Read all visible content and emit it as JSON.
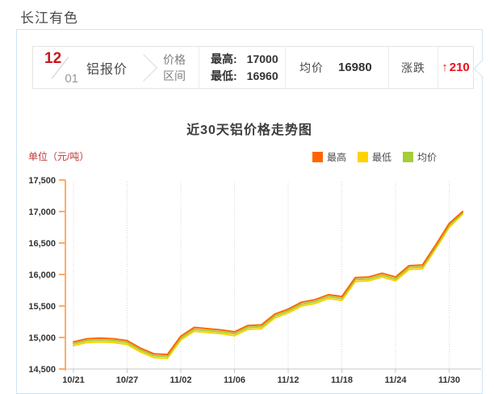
{
  "page_title": "长江有色",
  "quote_bar": {
    "date_month": "12",
    "date_day": "01",
    "product": "铝报价",
    "range_label_1": "价格",
    "range_label_2": "区间",
    "high_label": "最高:",
    "high_value": "17000",
    "low_label": "最低:",
    "low_value": "16960",
    "avg_label": "均价",
    "avg_value": "16980",
    "change_label": "涨跌",
    "change_arrow": "↑",
    "change_value": "210",
    "change_color": "#e8111d"
  },
  "chart": {
    "title": "近30天铝价格走势图",
    "unit_label": "单位（元/吨）"
  },
  "chart_data": {
    "type": "line",
    "title": "近30天铝价格走势图",
    "ylabel": "单位（元/吨）",
    "ylim": [
      14500,
      17500
    ],
    "y_ticks": [
      "17,500",
      "17,000",
      "16,500",
      "16,000",
      "15,500",
      "15,000",
      "14,500"
    ],
    "x_tick_labels": [
      "10/21",
      "10/27",
      "11/02",
      "11/06",
      "11/12",
      "11/18",
      "11/24",
      "11/30"
    ],
    "x_tick_indices": [
      0,
      4,
      8,
      12,
      16,
      20,
      24,
      28
    ],
    "grid": "vertical-dotted",
    "legend_position": "top-right",
    "axis_colors": {
      "y_axis": "#ffab66",
      "x_axis": "#c9c9c9",
      "gridline": "#d9d9d9",
      "tick_label": "#333333"
    },
    "draw_order": [
      1,
      2,
      0
    ],
    "series": [
      {
        "key": "high",
        "name": "最高",
        "color": "#ff6600",
        "values": [
          14930,
          14980,
          14990,
          14980,
          14950,
          14830,
          14740,
          14730,
          15020,
          15160,
          15140,
          15120,
          15090,
          15190,
          15200,
          15370,
          15450,
          15560,
          15600,
          15680,
          15650,
          15950,
          15960,
          16020,
          15960,
          16140,
          16150,
          16470,
          16810,
          17000
        ]
      },
      {
        "key": "low",
        "name": "最低",
        "color": "#ffd200",
        "values": [
          14870,
          14920,
          14930,
          14920,
          14890,
          14770,
          14680,
          14670,
          14960,
          15100,
          15080,
          15060,
          15030,
          15130,
          15140,
          15310,
          15390,
          15500,
          15540,
          15620,
          15590,
          15890,
          15900,
          15960,
          15900,
          16080,
          16090,
          16410,
          16750,
          16960
        ]
      },
      {
        "key": "avg",
        "name": "均价",
        "color": "#a5cd39",
        "values": [
          14900,
          14950,
          14960,
          14950,
          14920,
          14800,
          14710,
          14700,
          14990,
          15130,
          15110,
          15090,
          15060,
          15160,
          15170,
          15340,
          15420,
          15530,
          15570,
          15650,
          15620,
          15920,
          15930,
          15990,
          15930,
          16110,
          16120,
          16440,
          16780,
          16980
        ]
      }
    ]
  }
}
